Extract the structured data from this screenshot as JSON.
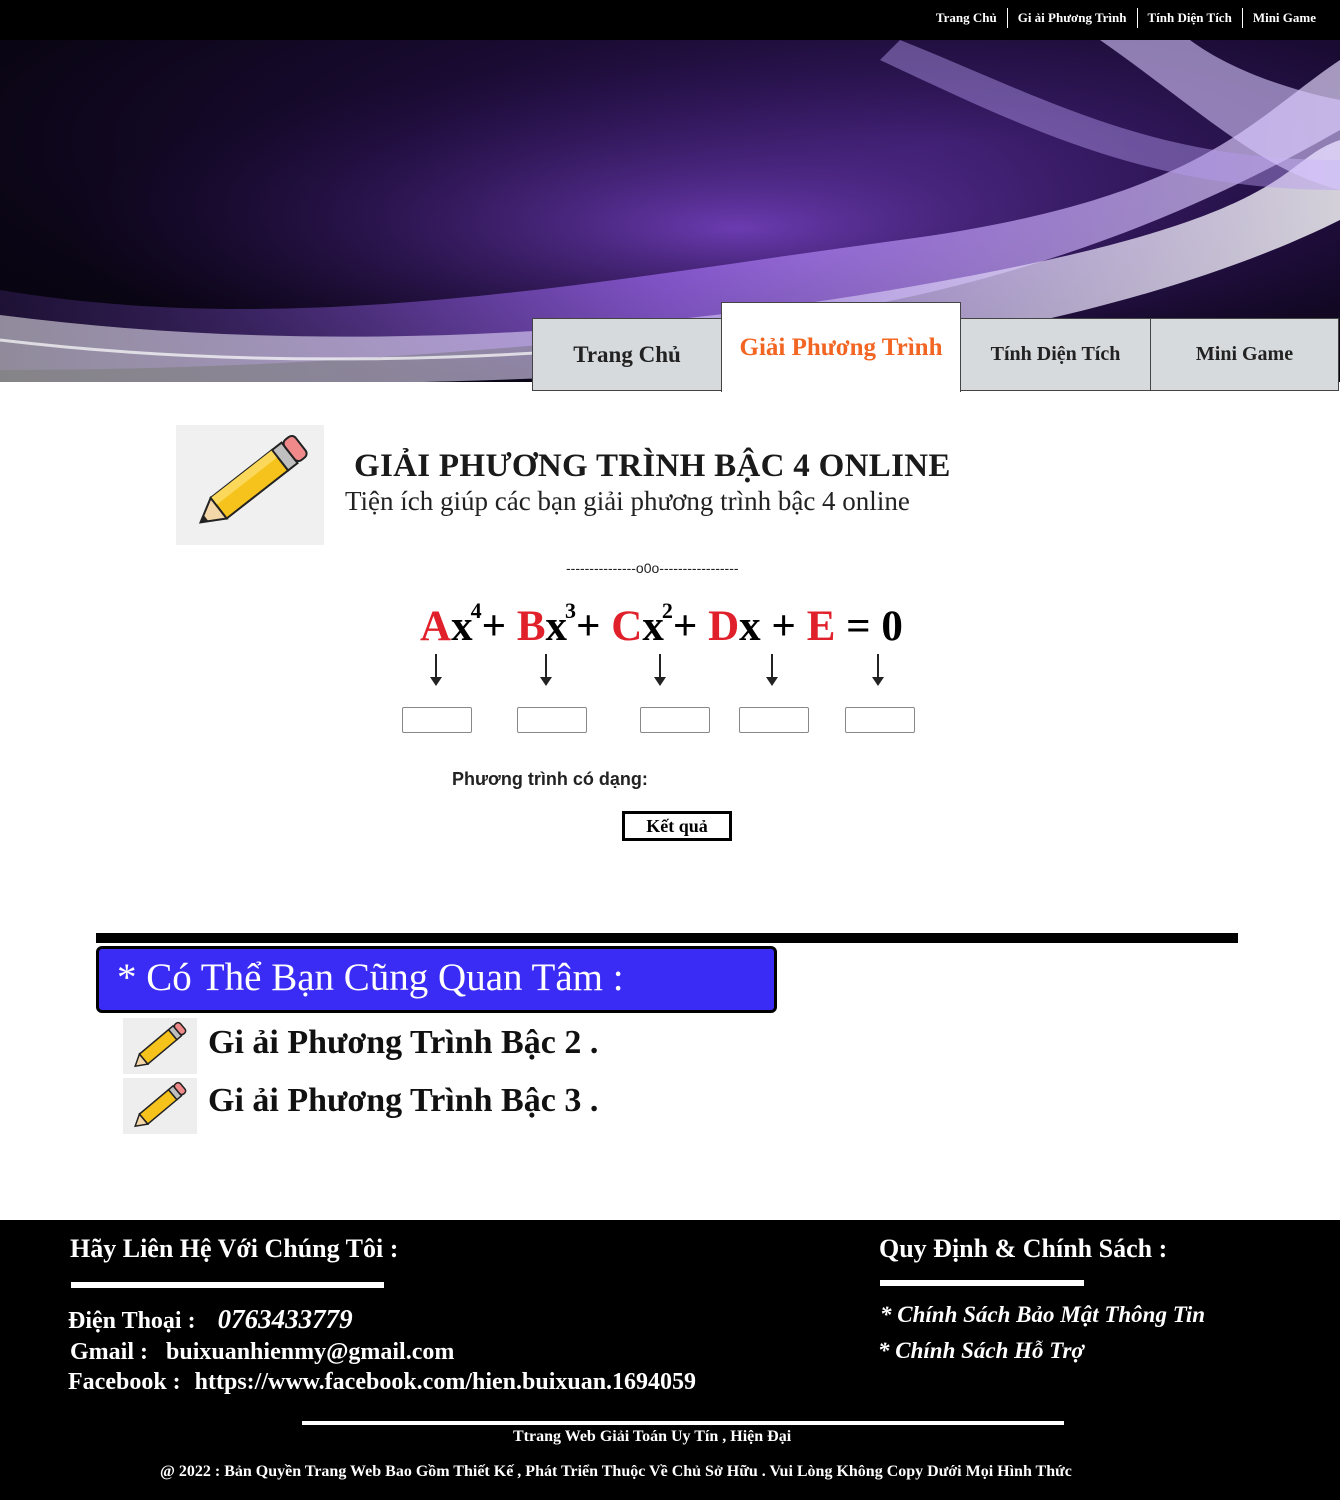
{
  "topnav": [
    "Trang Chủ",
    "Gi ải Phương Trình",
    "Tính Diện Tích",
    "Mini Game"
  ],
  "tabs": [
    "Trang Chủ",
    "Giải Phương Trình",
    "Tính Diện Tích",
    "Mini Game"
  ],
  "main": {
    "title": "GIẢI PHƯƠNG TRÌNH BẬC 4 ONLINE",
    "subtitle": "Tiện ích giúp các bạn giải phương trình bậc 4 online",
    "divider": "---------------o0o-----------------",
    "equation": {
      "a": "A",
      "x1": "x",
      "e1": "4",
      "p1": "+",
      "b": "B",
      "x2": "x",
      "e2": "3",
      "p2": "+",
      "c": "C",
      "x3": "x",
      "e3": "2",
      "p3": "+",
      "d": "D",
      "x4": "x",
      "p4": "+",
      "e": "E",
      "eq": "= 0"
    },
    "form_label": "Phương trình có dạng:",
    "result_button": "Kết quả"
  },
  "related": {
    "heading": "* Có Thể Bạn Cũng Quan Tâm :",
    "items": [
      "Gi ải Phương Trình Bậc 2 .",
      "Gi ải Phương Trình Bậc 3 ."
    ]
  },
  "footer": {
    "contact_heading": "Hãy Liên Hệ Với Chúng Tôi :",
    "phone_label": "Điện Thoại :",
    "phone": "0763433779",
    "gmail_label": "Gmail :",
    "gmail": "buixuanhienmy@gmail.com",
    "facebook_label": "Facebook :",
    "facebook": "https://www.facebook.com/hien.buixuan.1694059",
    "policy_heading": "Quy Định & Chính Sách :",
    "policies": [
      "* Chính Sách Bảo Mật Thông Tin",
      "* Chính Sách Hỗ Trợ"
    ],
    "tagline": "Ttrang Web Giải Toán Uy Tín , Hiện Đại",
    "copyright": "@ 2022 : Bản Quyền Trang Web Bao Gồm Thiết Kế , Phát Triển Thuộc Về Chủ Sở Hữu . Vui Lòng Không Copy Dưới Mọi Hình Thức"
  },
  "colors": {
    "active_tab": "#f26522",
    "coefficient_red": "#e0202a",
    "interest_box": "#3b2cf5",
    "tab_bg": "#d7dadc"
  }
}
